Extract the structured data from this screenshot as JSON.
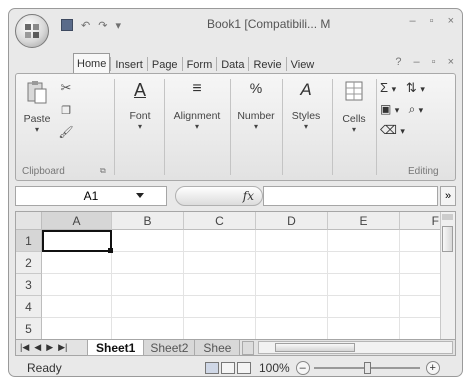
{
  "window": {
    "title": "Book1 [Compatibili... M",
    "controls": [
      "–",
      "▫",
      "×"
    ]
  },
  "ribbon_tabs": [
    "Home",
    "Insert",
    "Page",
    "Form",
    "Data",
    "Revie",
    "View"
  ],
  "ribbon_tab_extras": [
    "–",
    "▫",
    "×"
  ],
  "ribbon": {
    "clipboard": {
      "paste_label": "Paste",
      "group_label": "Clipboard"
    },
    "font": {
      "label": "Font"
    },
    "alignment": {
      "label": "Alignment"
    },
    "number": {
      "label": "Number"
    },
    "styles": {
      "label": "Styles"
    },
    "cells": {
      "label": "Cells"
    },
    "editing": {
      "group_label": "Editing"
    }
  },
  "formula_bar": {
    "name_box": "A1",
    "fx": "fx",
    "expand": "»"
  },
  "grid": {
    "columns": [
      "A",
      "B",
      "C",
      "D",
      "E",
      "F"
    ],
    "rows": [
      "1",
      "2",
      "3",
      "4",
      "5"
    ],
    "selected_cell": "A1"
  },
  "sheet_nav": [
    "|◀",
    "◀",
    "▶",
    "▶|"
  ],
  "sheet_tabs": [
    "Sheet1",
    "Sheet2",
    "Shee"
  ],
  "status_bar": {
    "state": "Ready",
    "zoom": "100%",
    "zoom_out": "–",
    "zoom_in": "+"
  }
}
